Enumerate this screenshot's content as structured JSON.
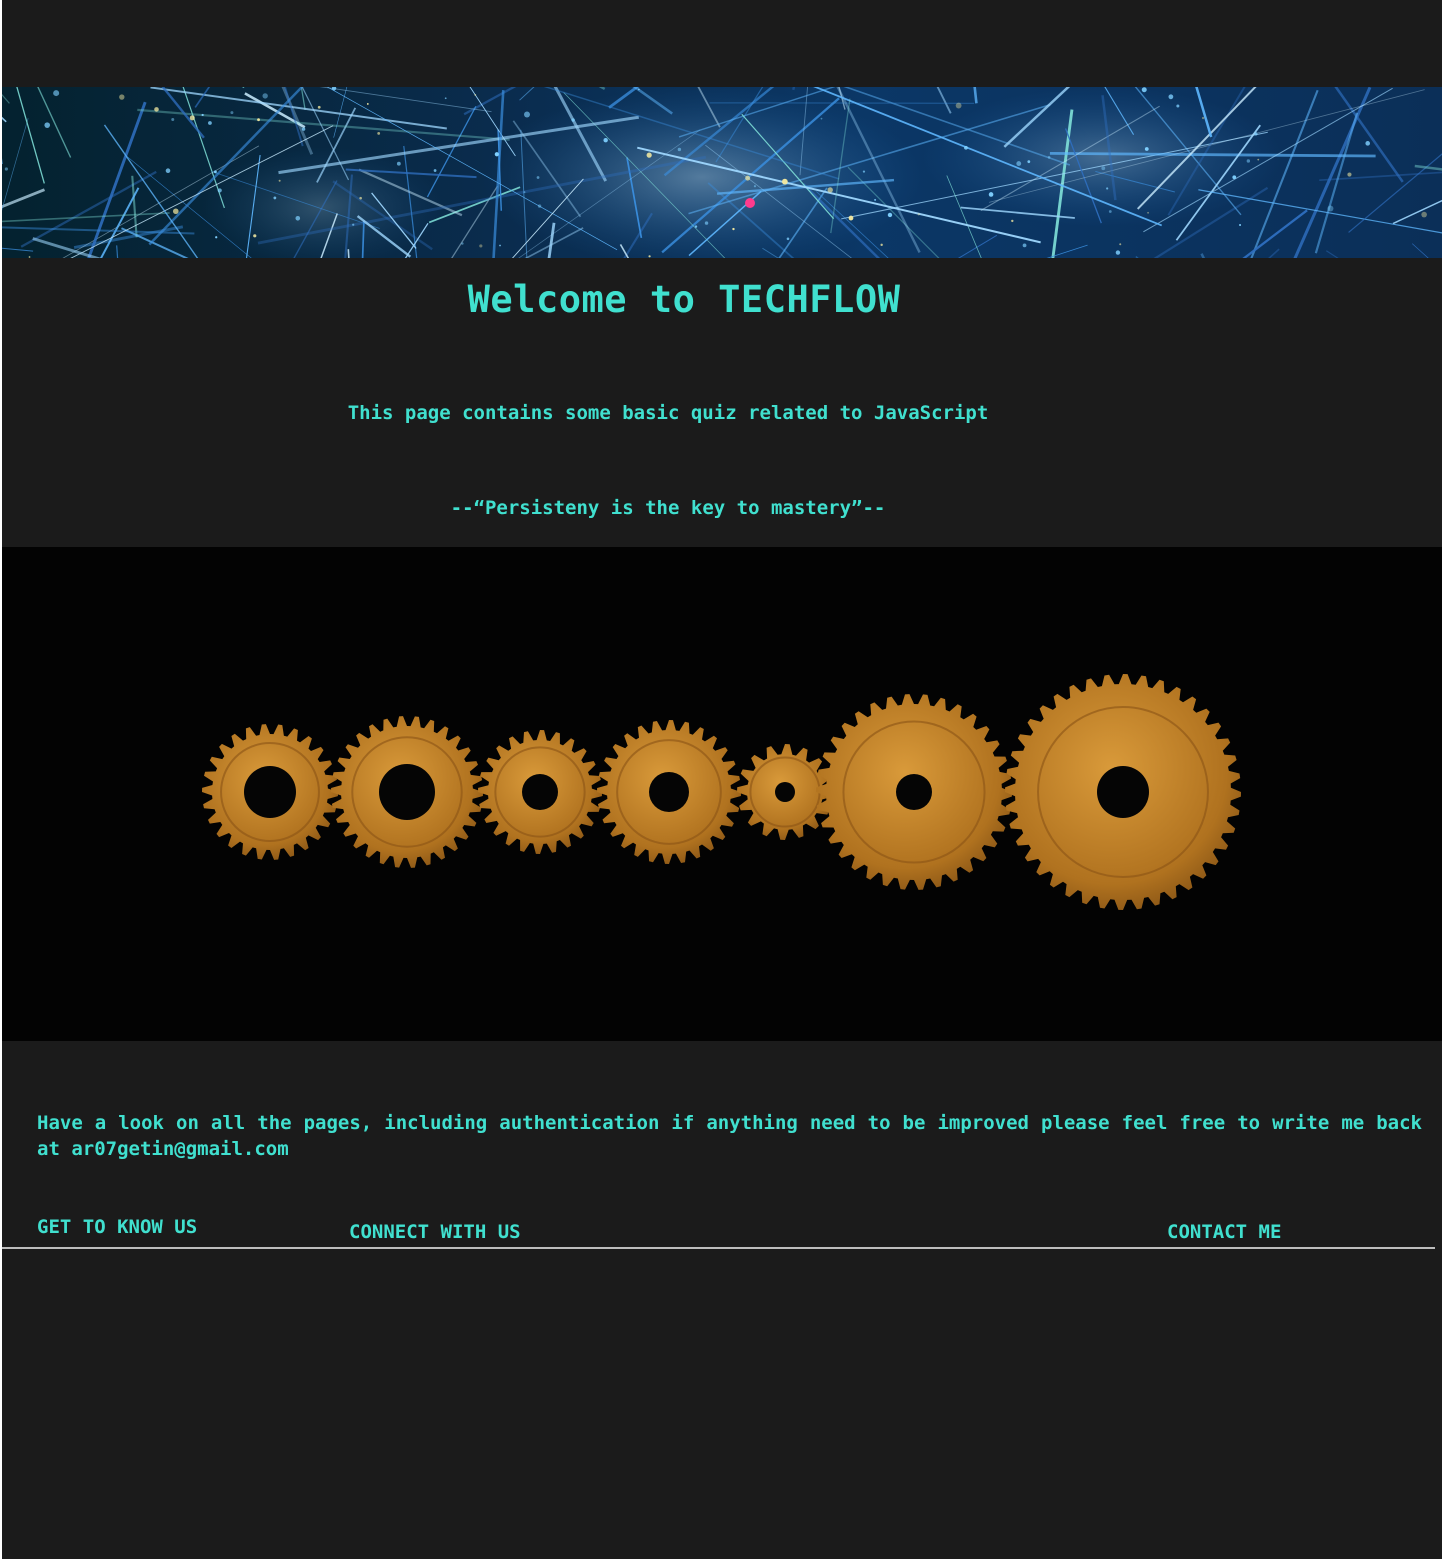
{
  "hero": {
    "title": "Welcome to TECHFLOW",
    "subtitle": "This page contains some basic quiz related to JavaScript",
    "quote": "--“Persisteny is the key to mastery”--"
  },
  "main": {
    "notice": "Have a look on all the pages, including authentication if anything need to be improved please feel free to write me back at ar07getin@gmail.com"
  },
  "footer": {
    "links": [
      "GET TO KNOW US",
      "CONNECT WITH US",
      "CONTACT ME"
    ]
  },
  "colors": {
    "background": "#1b1b1b",
    "accent": "#40e0cf",
    "rule": "#bdbdbd"
  }
}
